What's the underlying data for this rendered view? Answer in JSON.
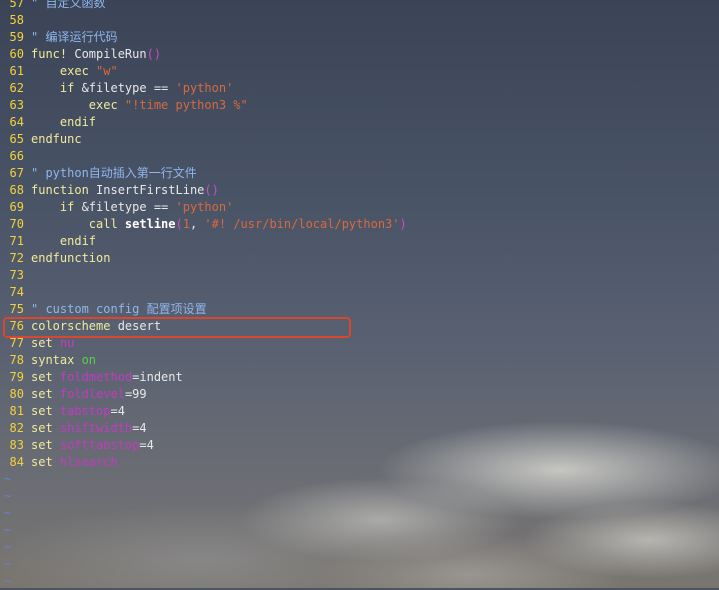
{
  "editor": {
    "lines": [
      {
        "num": "57",
        "parts": [
          {
            "t": "\" 自定义函数",
            "c": "comment"
          }
        ]
      },
      {
        "num": "58",
        "parts": []
      },
      {
        "num": "59",
        "parts": [
          {
            "t": "\" 编译运行代码",
            "c": "comment"
          }
        ]
      },
      {
        "num": "60",
        "parts": [
          {
            "t": "func! ",
            "c": "kw"
          },
          {
            "t": "CompileRun",
            "c": "fn"
          },
          {
            "t": "()",
            "c": "brace"
          }
        ]
      },
      {
        "num": "61",
        "parts": [
          {
            "t": "    exec ",
            "c": "kw"
          },
          {
            "t": "\"w\"",
            "c": "str"
          }
        ]
      },
      {
        "num": "62",
        "parts": [
          {
            "t": "    if ",
            "c": "kw"
          },
          {
            "t": "&filetype == ",
            "c": "txt"
          },
          {
            "t": "'python'",
            "c": "str"
          }
        ]
      },
      {
        "num": "63",
        "parts": [
          {
            "t": "        exec ",
            "c": "kw"
          },
          {
            "t": "\"!time python3 %\"",
            "c": "str"
          }
        ]
      },
      {
        "num": "64",
        "parts": [
          {
            "t": "    endif",
            "c": "kw"
          }
        ]
      },
      {
        "num": "65",
        "parts": [
          {
            "t": "endfunc",
            "c": "kw"
          }
        ]
      },
      {
        "num": "66",
        "parts": []
      },
      {
        "num": "67",
        "parts": [
          {
            "t": "\" python自动插入第一行文件",
            "c": "comment"
          }
        ]
      },
      {
        "num": "68",
        "parts": [
          {
            "t": "function ",
            "c": "kw"
          },
          {
            "t": "InsertFirstLine",
            "c": "fn"
          },
          {
            "t": "()",
            "c": "brace"
          }
        ]
      },
      {
        "num": "69",
        "parts": [
          {
            "t": "    if ",
            "c": "kw"
          },
          {
            "t": "&filetype == ",
            "c": "txt"
          },
          {
            "t": "'python'",
            "c": "str"
          }
        ]
      },
      {
        "num": "70",
        "parts": [
          {
            "t": "        call ",
            "c": "kw"
          },
          {
            "t": "setline",
            "c": "bold"
          },
          {
            "t": "(",
            "c": "brace"
          },
          {
            "t": "1",
            "c": "str"
          },
          {
            "t": ", ",
            "c": "txt"
          },
          {
            "t": "'#! /usr/bin/local/python3'",
            "c": "str"
          },
          {
            "t": ")",
            "c": "brace"
          }
        ]
      },
      {
        "num": "71",
        "parts": [
          {
            "t": "    endif",
            "c": "kw"
          }
        ]
      },
      {
        "num": "72",
        "parts": [
          {
            "t": "endfunction",
            "c": "kw"
          }
        ]
      },
      {
        "num": "73",
        "parts": []
      },
      {
        "num": "74",
        "parts": []
      },
      {
        "num": "75",
        "parts": [
          {
            "t": "\" custom config 配置项设置",
            "c": "comment"
          }
        ]
      },
      {
        "num": "76",
        "parts": [
          {
            "t": "colorscheme ",
            "c": "kw"
          },
          {
            "t": "desert",
            "c": "txt"
          }
        ]
      },
      {
        "num": "77",
        "parts": [
          {
            "t": "set ",
            "c": "kw"
          },
          {
            "t": "nu",
            "c": "opt"
          }
        ]
      },
      {
        "num": "78",
        "parts": [
          {
            "t": "syntax ",
            "c": "kw"
          },
          {
            "t": "on",
            "c": "on"
          }
        ]
      },
      {
        "num": "79",
        "parts": [
          {
            "t": "set ",
            "c": "kw"
          },
          {
            "t": "foldmethod",
            "c": "opt"
          },
          {
            "t": "=indent",
            "c": "val"
          }
        ]
      },
      {
        "num": "80",
        "parts": [
          {
            "t": "set ",
            "c": "kw"
          },
          {
            "t": "foldlevel",
            "c": "opt"
          },
          {
            "t": "=99",
            "c": "val"
          }
        ]
      },
      {
        "num": "81",
        "parts": [
          {
            "t": "set ",
            "c": "kw"
          },
          {
            "t": "tabstop",
            "c": "opt"
          },
          {
            "t": "=4",
            "c": "val"
          }
        ]
      },
      {
        "num": "82",
        "parts": [
          {
            "t": "set ",
            "c": "kw"
          },
          {
            "t": "shiftwidth",
            "c": "opt"
          },
          {
            "t": "=4",
            "c": "val"
          }
        ]
      },
      {
        "num": "83",
        "parts": [
          {
            "t": "set ",
            "c": "kw"
          },
          {
            "t": "softtabstop",
            "c": "opt"
          },
          {
            "t": "=4",
            "c": "val"
          }
        ]
      },
      {
        "num": "84",
        "parts": [
          {
            "t": "set ",
            "c": "kw"
          },
          {
            "t": "hlsearch",
            "c": "opt"
          }
        ]
      }
    ],
    "tildes": [
      "~",
      "~",
      "~",
      "~",
      "~",
      "~",
      "~"
    ],
    "highlighted_line": "76"
  },
  "colors": {
    "highlight_border": "#d9472c",
    "line_number": "#f5d23a",
    "comment": "#8fb6ec",
    "keyword": "#f2ea9b",
    "string": "#d86a3d"
  }
}
